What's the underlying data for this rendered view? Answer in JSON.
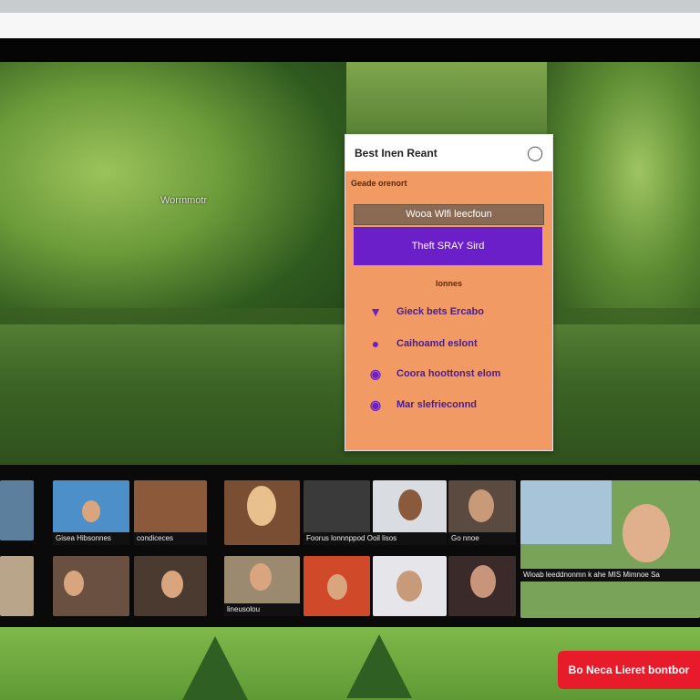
{
  "hero": {
    "sign_text": "Wormmotr"
  },
  "panel": {
    "title": "Best Inen Reant",
    "section_label": "Geade orenort",
    "gray_button": "Wooa Wlfi leecfoun",
    "purple_button": "Theft SRAY Sird",
    "sub_label": "lonnes",
    "options": [
      {
        "icon": "shield-icon",
        "label": "Gieck bets Ercabo"
      },
      {
        "icon": "chat-icon",
        "label": "Caihoamd eslont"
      },
      {
        "icon": "location-icon",
        "label": "Coora hoottonst elom"
      },
      {
        "icon": "message-icon",
        "label": "Mar slefrieconnd"
      }
    ]
  },
  "gallery": {
    "captions": [
      "Gisea Hibsonnes",
      "condiceces",
      "Foorus lonnnppod Ooil lisos",
      "Go nnoe",
      "lineusolou",
      "Wioab leeddnonmn k ahe MIS Mimnoe Sa"
    ]
  },
  "cta": {
    "label": "Bo Neca Lieret bontbor"
  },
  "colors": {
    "panel": "#f19a63",
    "accent": "#6b1fc8",
    "cta": "#e81b2b"
  }
}
